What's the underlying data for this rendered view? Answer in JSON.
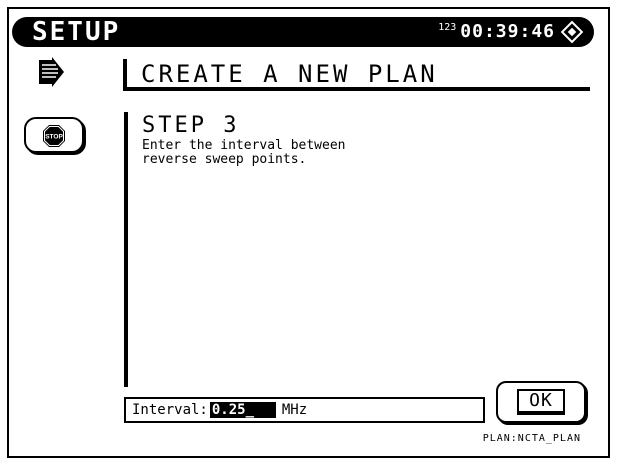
{
  "header": {
    "title": "SETUP",
    "clock_badge": "123",
    "clock": "00:39:46",
    "status_icon": "diamond-indicator-icon"
  },
  "plan_icon": "plan-arrow-icon",
  "heading": "CREATE A NEW PLAN",
  "stop_button": {
    "icon": "stop-icon",
    "label": "STOP"
  },
  "step": {
    "title": "STEP 3",
    "line1": "Enter the interval between",
    "line2": "reverse sweep points."
  },
  "interval": {
    "label": "Interval:",
    "value": "0.25_",
    "unit": "MHz"
  },
  "ok_button": {
    "label": "OK"
  },
  "footer": {
    "plan": "PLAN:NCTA_PLAN"
  }
}
